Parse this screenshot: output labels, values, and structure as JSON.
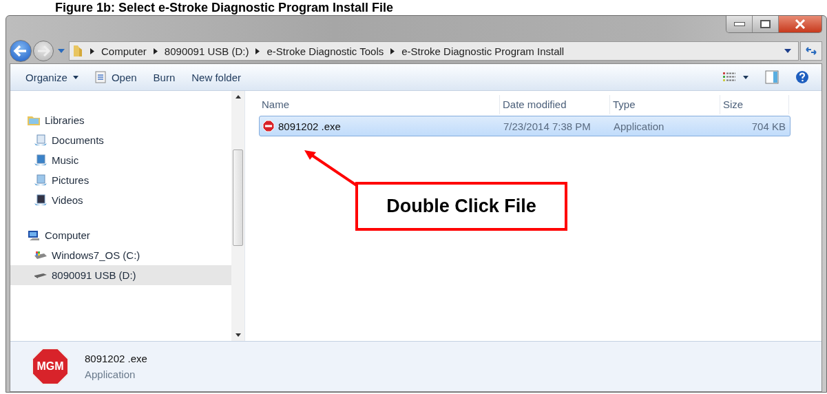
{
  "caption": "Figure 1b: Select e-Stroke Diagnostic Program Install File",
  "window": {
    "controls": [
      {
        "kind": "minimize"
      },
      {
        "kind": "maximize"
      },
      {
        "kind": "close"
      }
    ]
  },
  "address_bar": {
    "crumbs": [
      "Computer",
      "8090091 USB (D:)",
      "e-Stroke Diagnostic Tools",
      "e-Stroke Diagnostic Program Install"
    ]
  },
  "toolbar": {
    "items": [
      {
        "label": "Organize",
        "menu": true
      },
      {
        "label": "Open",
        "menu": false
      },
      {
        "label": "Burn",
        "menu": false
      },
      {
        "label": "New folder",
        "menu": false
      }
    ]
  },
  "nav_pane": {
    "groups": [
      {
        "label": "Libraries",
        "selected": false,
        "children": [
          {
            "label": "Documents",
            "selected": false
          },
          {
            "label": "Music",
            "selected": false
          },
          {
            "label": "Pictures",
            "selected": false
          },
          {
            "label": "Videos",
            "selected": false
          }
        ]
      },
      {
        "label": "Computer",
        "selected": false,
        "children": [
          {
            "label": "Windows7_OS (C:)",
            "selected": false
          },
          {
            "label": "8090091 USB (D:)",
            "selected": true
          }
        ]
      }
    ]
  },
  "file_list": {
    "columns": [
      "Name",
      "Date modified",
      "Type",
      "Size"
    ],
    "rows": [
      {
        "cells": [
          "8091202 .exe",
          "7/23/2014 7:38 PM",
          "Application",
          "704 KB"
        ],
        "selected": true
      }
    ]
  },
  "callout": {
    "text": "Double Click File"
  },
  "details_pane": {
    "icon_text": "MGM",
    "name": "8091202 .exe",
    "type": "Application"
  }
}
